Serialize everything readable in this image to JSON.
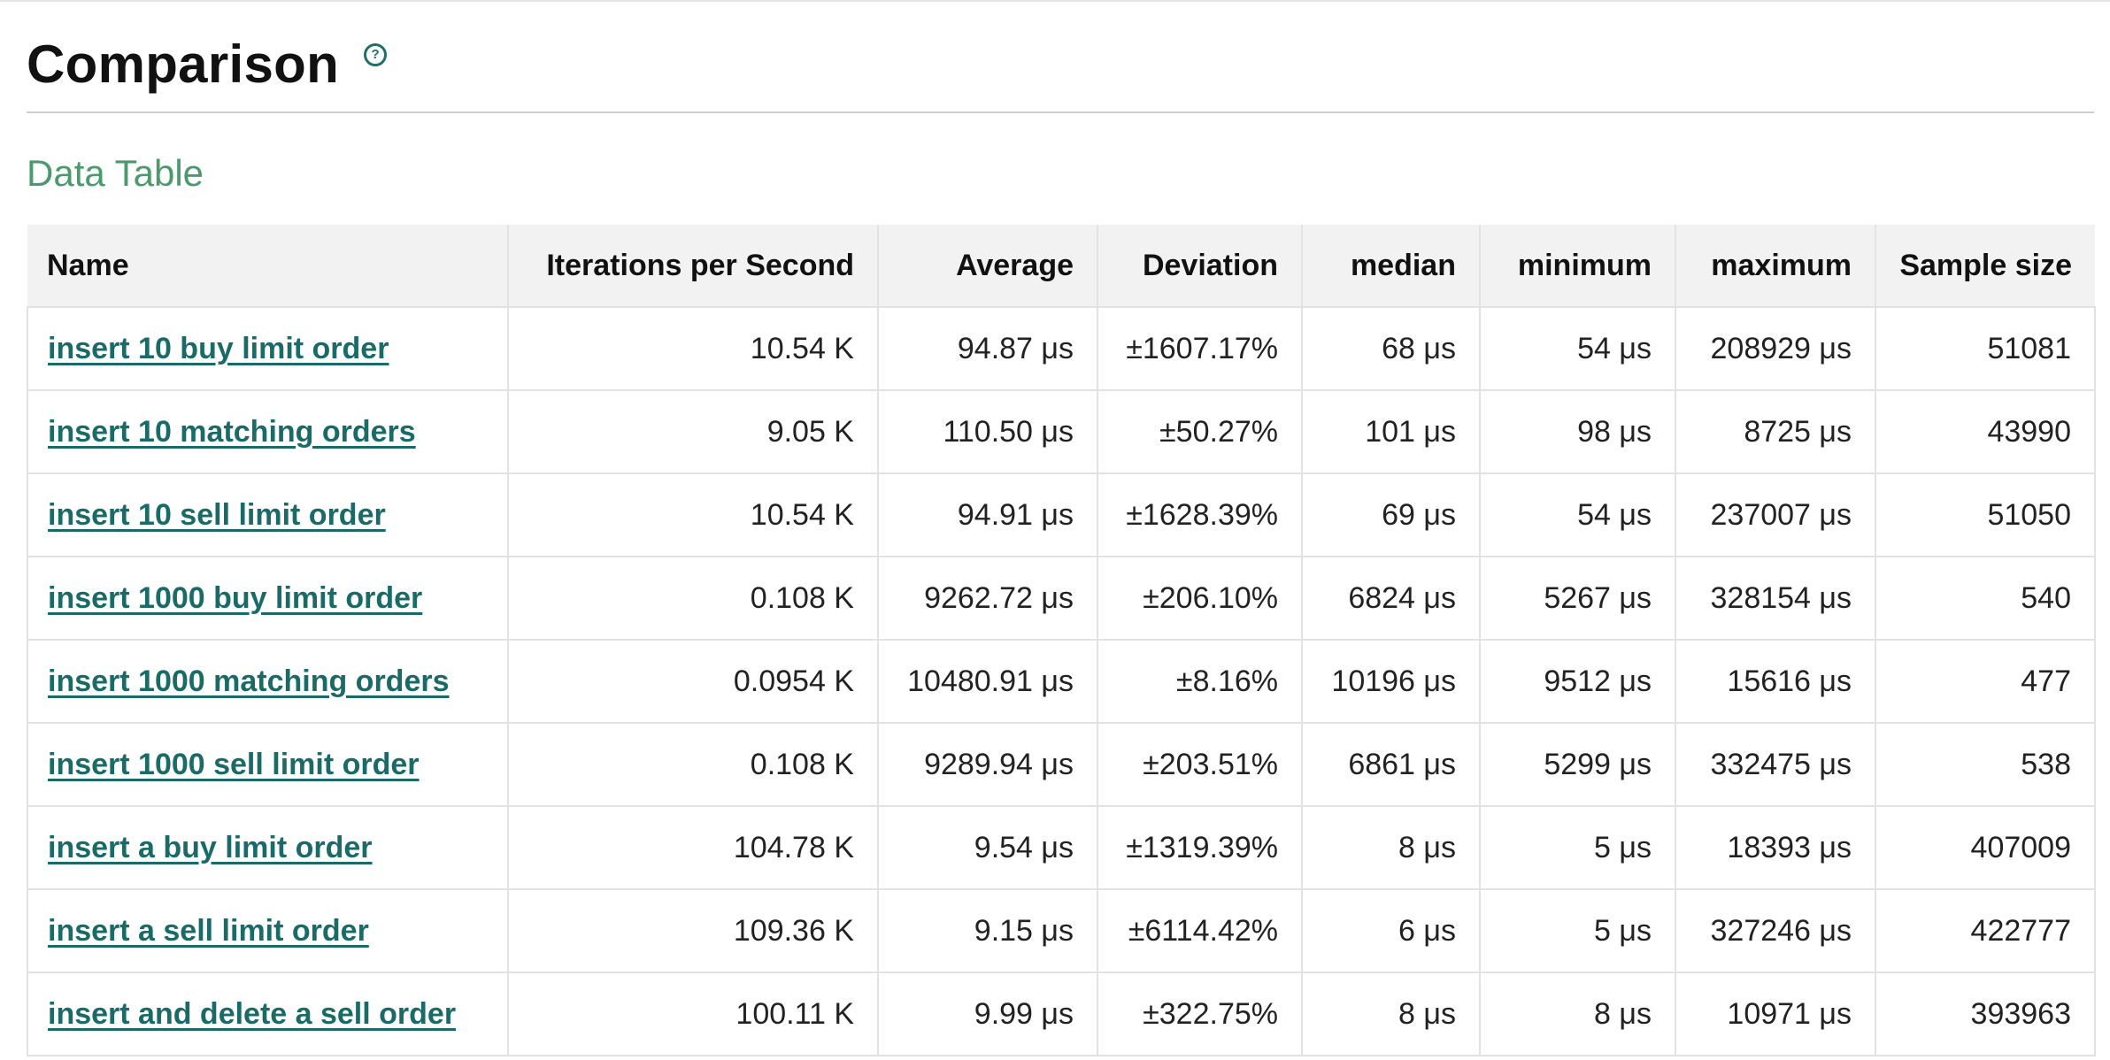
{
  "header": {
    "title": "Comparison",
    "help_icon": "question-circle-icon",
    "help_glyph": "?"
  },
  "section": {
    "title": "Data Table"
  },
  "colors": {
    "link": "#1a6b68",
    "section_title": "#4a9a6d",
    "header_bg": "#f2f2f2"
  },
  "table": {
    "columns": [
      "Name",
      "Iterations per Second",
      "Average",
      "Deviation",
      "median",
      "minimum",
      "maximum",
      "Sample size"
    ],
    "rows": [
      {
        "name": "insert 10 buy limit order",
        "ips": "10.54 K",
        "average": "94.87 μs",
        "deviation": "±1607.17%",
        "median": "68 μs",
        "minimum": "54 μs",
        "maximum": "208929 μs",
        "sample_size": "51081"
      },
      {
        "name": "insert 10 matching orders",
        "ips": "9.05 K",
        "average": "110.50 μs",
        "deviation": "±50.27%",
        "median": "101 μs",
        "minimum": "98 μs",
        "maximum": "8725 μs",
        "sample_size": "43990"
      },
      {
        "name": "insert 10 sell limit order",
        "ips": "10.54 K",
        "average": "94.91 μs",
        "deviation": "±1628.39%",
        "median": "69 μs",
        "minimum": "54 μs",
        "maximum": "237007 μs",
        "sample_size": "51050"
      },
      {
        "name": "insert 1000 buy limit order",
        "ips": "0.108 K",
        "average": "9262.72 μs",
        "deviation": "±206.10%",
        "median": "6824 μs",
        "minimum": "5267 μs",
        "maximum": "328154 μs",
        "sample_size": "540"
      },
      {
        "name": "insert 1000 matching orders",
        "ips": "0.0954 K",
        "average": "10480.91 μs",
        "deviation": "±8.16%",
        "median": "10196 μs",
        "minimum": "9512 μs",
        "maximum": "15616 μs",
        "sample_size": "477"
      },
      {
        "name": "insert 1000 sell limit order",
        "ips": "0.108 K",
        "average": "9289.94 μs",
        "deviation": "±203.51%",
        "median": "6861 μs",
        "minimum": "5299 μs",
        "maximum": "332475 μs",
        "sample_size": "538"
      },
      {
        "name": "insert a buy limit order",
        "ips": "104.78 K",
        "average": "9.54 μs",
        "deviation": "±1319.39%",
        "median": "8 μs",
        "minimum": "5 μs",
        "maximum": "18393 μs",
        "sample_size": "407009"
      },
      {
        "name": "insert a sell limit order",
        "ips": "109.36 K",
        "average": "9.15 μs",
        "deviation": "±6114.42%",
        "median": "6 μs",
        "minimum": "5 μs",
        "maximum": "327246 μs",
        "sample_size": "422777"
      },
      {
        "name": "insert and delete a sell order",
        "ips": "100.11 K",
        "average": "9.99 μs",
        "deviation": "±322.75%",
        "median": "8 μs",
        "minimum": "8 μs",
        "maximum": "10971 μs",
        "sample_size": "393963"
      }
    ]
  }
}
